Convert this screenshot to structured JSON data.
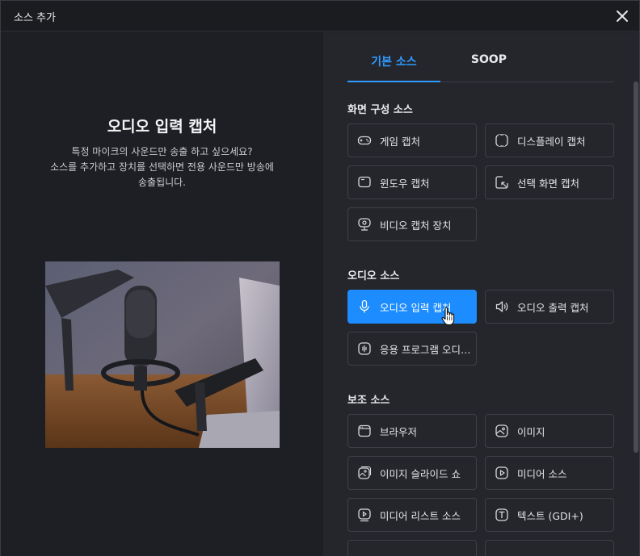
{
  "window": {
    "title": "소스 추가"
  },
  "left": {
    "title": "오디오 입력 캡처",
    "desc_lines": [
      "특정 마이크의 사운드만 송출 하고 싶으세요?",
      "소스를 추가하고 장치를 선택하면 전용 사운드만 방송에",
      "송출됩니다."
    ]
  },
  "tabs": [
    {
      "label": "기본 소스",
      "active": true
    },
    {
      "label": "SOOP",
      "active": false
    }
  ],
  "sections": {
    "screen": {
      "title": "화면 구성 소스",
      "items": [
        {
          "label": "게임 캡처",
          "icon": "gamepad-icon"
        },
        {
          "label": "디스플레이 캡처",
          "icon": "display-frame-icon"
        },
        {
          "label": "윈도우 캡처",
          "icon": "window-icon"
        },
        {
          "label": "선택 화면 캡처",
          "icon": "region-select-icon"
        },
        {
          "label": "비디오 캡처 장치",
          "icon": "webcam-icon"
        }
      ]
    },
    "audio": {
      "title": "오디오 소스",
      "items": [
        {
          "label": "오디오 입력 캡처",
          "icon": "microphone-icon",
          "selected": true
        },
        {
          "label": "오디오 출력 캡처",
          "icon": "speaker-icon"
        },
        {
          "label": "응용 프로그램 오디오 캡처",
          "icon": "app-audio-icon"
        }
      ]
    },
    "aux": {
      "title": "보조 소스",
      "items": [
        {
          "label": "브라우저",
          "icon": "browser-icon"
        },
        {
          "label": "이미지",
          "icon": "image-icon"
        },
        {
          "label": "이미지 슬라이드 쇼",
          "icon": "slideshow-icon"
        },
        {
          "label": "미디어 소스",
          "icon": "media-play-icon"
        },
        {
          "label": "미디어 리스트 소스",
          "icon": "media-list-icon"
        },
        {
          "label": "텍스트 (GDI+)",
          "icon": "text-icon"
        }
      ]
    }
  },
  "colors": {
    "accent": "#1c8cff",
    "tab_active": "#2f9bff"
  }
}
